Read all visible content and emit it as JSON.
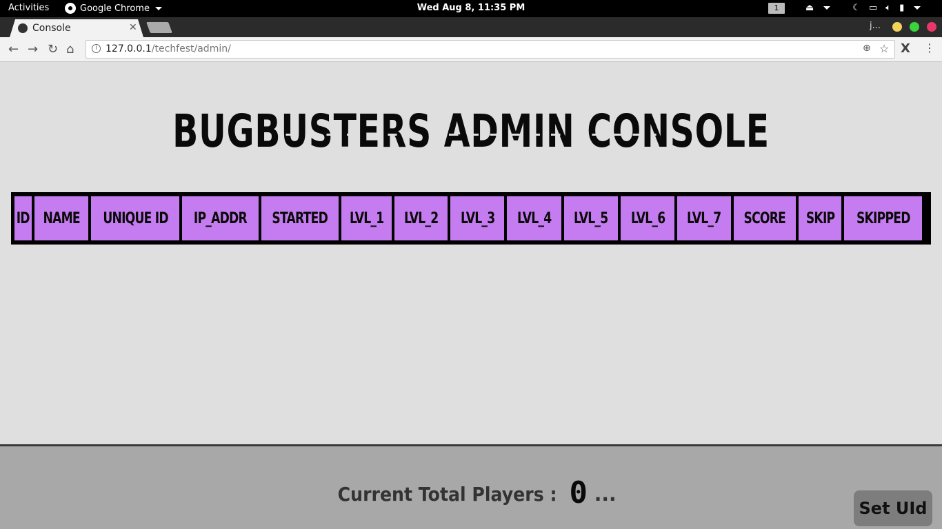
{
  "system_bar": {
    "activities": "Activities",
    "app_name": "Google Chrome",
    "clock": "Wed Aug  8, 11:35 PM",
    "workspace": "1"
  },
  "browser": {
    "tab_title": "Console",
    "profile_initial": "j...",
    "url_host": "127.0.0.1",
    "url_path": "/techfest/admin/",
    "extension_label": "X"
  },
  "page": {
    "title": "BUGBUSTERS ADMIN CONSOLE",
    "table_headers": [
      "ID",
      "NAME",
      "UNIQUE ID",
      "IP_ADDR",
      "STARTED",
      "LVL_1",
      "LVL_2",
      "LVL_3",
      "LVL_4",
      "LVL_5",
      "LVL_6",
      "LVL_7",
      "SCORE",
      "SKIP",
      "SKIPPED"
    ]
  },
  "footer": {
    "players_label": "Current Total Players : ",
    "players_count": "0",
    "players_suffix": " ...",
    "set_uid_button": "Set UId"
  },
  "colors": {
    "header_cell": "#c57cf0",
    "page_bg": "#dfdfdf",
    "footer_bg": "#a8a8a8",
    "window_close": "#e8386a",
    "window_maximize": "#3bd43b",
    "window_minimize": "#f1d25a"
  },
  "icons": [
    "chrome-icon",
    "close-icon",
    "back-icon",
    "forward-icon",
    "reload-icon",
    "home-icon",
    "info-icon",
    "zoom-icon",
    "star-icon",
    "extension-icon",
    "menu-icon",
    "night-icon",
    "screen-icon",
    "volume-icon",
    "battery-icon"
  ]
}
